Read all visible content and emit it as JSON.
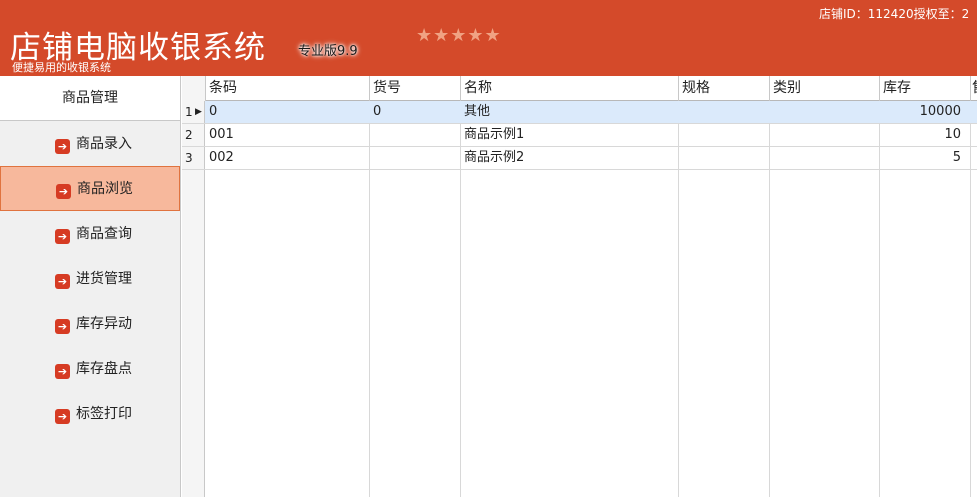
{
  "header": {
    "title": "店铺电脑收银系统",
    "edition": "专业版9.9",
    "subtitle": "便捷易用的收银系统",
    "stars": "★★★★★",
    "store_info": "店铺ID：112420授权至：2"
  },
  "sidebar": {
    "header": "商品管理",
    "items": [
      {
        "label": "商品录入",
        "icon": "arrow-right-icon"
      },
      {
        "label": "商品浏览",
        "icon": "arrow-right-icon",
        "active": true
      },
      {
        "label": "商品查询",
        "icon": "arrow-right-icon"
      },
      {
        "label": "进货管理",
        "icon": "arrow-right-icon"
      },
      {
        "label": "库存异动",
        "icon": "arrow-right-icon"
      },
      {
        "label": "库存盘点",
        "icon": "arrow-right-icon"
      },
      {
        "label": "标签打印",
        "icon": "arrow-right-icon"
      }
    ],
    "arrow_glyph": "➔"
  },
  "grid": {
    "columns": [
      "条码",
      "货号",
      "名称",
      "规格",
      "类别",
      "库存",
      "售"
    ],
    "rows": [
      {
        "num": "1",
        "cells": [
          "0",
          "0",
          "其他",
          "",
          "",
          "10000"
        ]
      },
      {
        "num": "2",
        "cells": [
          "001",
          "",
          "商品示例1",
          "",
          "",
          "10"
        ]
      },
      {
        "num": "3",
        "cells": [
          "002",
          "",
          "商品示例2",
          "",
          "",
          "5"
        ]
      }
    ],
    "current_row_glyph": "▶"
  },
  "colors": {
    "header_bg": "#d44a2a",
    "active_item_bg": "#f7b89c",
    "selected_row_bg": "#dbeafb",
    "arrow_icon": "#d63b23"
  }
}
